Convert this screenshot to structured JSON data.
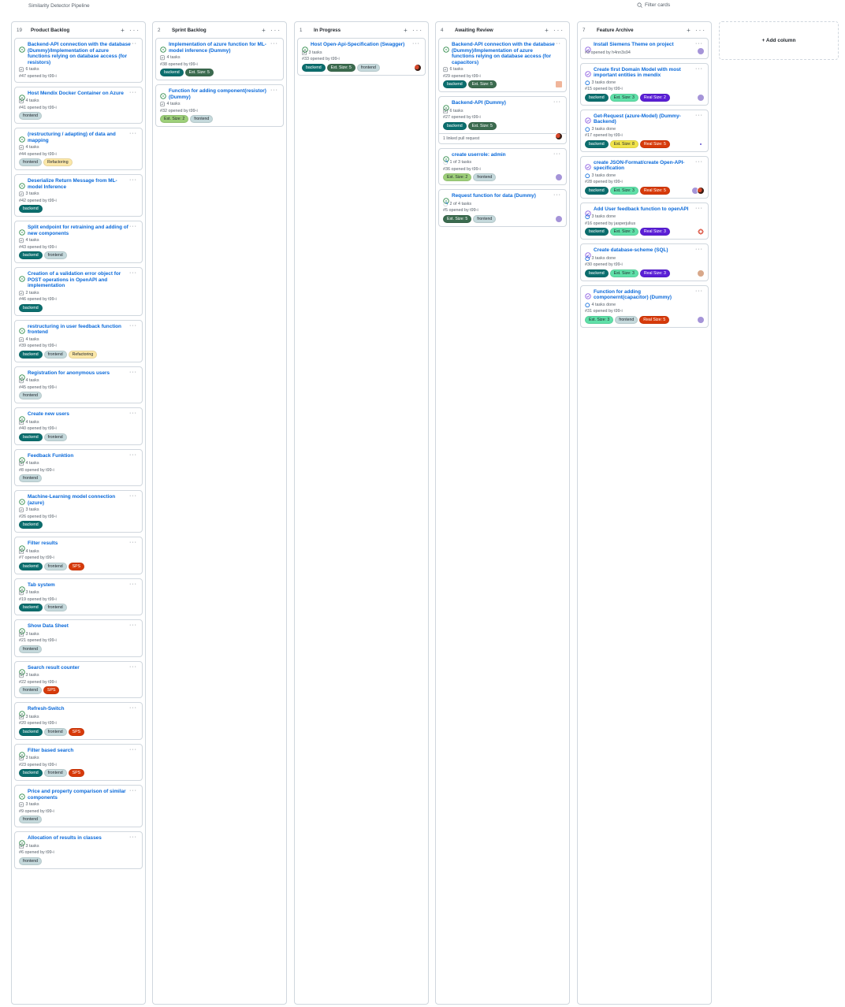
{
  "project_title": "Similarity Detector Pipeline",
  "filter": {
    "placeholder": "Filter cards"
  },
  "add_column": "+ Add column",
  "columns": [
    {
      "count": "19",
      "name": "Product Backlog",
      "cards": [
        {
          "title": "Backend-API connection with the database (Dummy)/Implementation of azure functions relying on database access (for resistors)",
          "tasks": "6 tasks",
          "opened": "#47 opened by t99-i",
          "labels": []
        },
        {
          "title": "Host Mendix Docker Container on Azure",
          "tasks": "4 tasks",
          "opened": "#41 opened by t99-i",
          "labels": [
            "frontend"
          ]
        },
        {
          "title": "(restructuring / adapting) of data and mapping",
          "tasks": "4 tasks",
          "opened": "#44 opened by t99-i",
          "labels": [
            "frontend",
            "Refactoring"
          ]
        },
        {
          "title": "Deserialize Return Message from ML-model Inference",
          "tasks": "3 tasks",
          "opened": "#42 opened by t99-i",
          "labels": [
            "backend"
          ]
        },
        {
          "title": "Split endpoint for retraining and adding of new components",
          "tasks": "4 tasks",
          "opened": "#43 opened by t99-i",
          "labels": [
            "backend",
            "frontend"
          ]
        },
        {
          "title": "Creation of a validation error object for POST operations in OpenAPI and implementation",
          "tasks": "2 tasks",
          "opened": "#46 opened by t99-i",
          "labels": [
            "backend"
          ]
        },
        {
          "title": "restructuring in user feedback function frontend",
          "tasks": "4 tasks",
          "opened": "#39 opened by t99-i",
          "labels": [
            "backend",
            "frontend",
            "Refactoring"
          ]
        },
        {
          "title": "Registration for anonymous users",
          "tasks": "4 tasks",
          "opened": "#45 opened by t99-i",
          "labels": [
            "frontend"
          ]
        },
        {
          "title": "Create new users",
          "tasks": "4 tasks",
          "opened": "#40 opened by t99-i",
          "labels": [
            "backend",
            "frontend"
          ]
        },
        {
          "title": "Feedback Funktion",
          "tasks": "4 tasks",
          "opened": "#8 opened by t99-i",
          "labels": [
            "frontend"
          ]
        },
        {
          "title": "Machine-Learning model connection (azure)",
          "tasks": "3 tasks",
          "opened": "#26 opened by t99-i",
          "labels": [
            "backend"
          ]
        },
        {
          "title": "Filter results",
          "tasks": "4 tasks",
          "opened": "#7 opened by t99-i",
          "labels": [
            "backend",
            "frontend",
            "SPS"
          ]
        },
        {
          "title": "Tab system",
          "tasks": "3 tasks",
          "opened": "#19 opened by t99-i",
          "labels": [
            "backend",
            "frontend"
          ]
        },
        {
          "title": "Show Data Sheet",
          "tasks": "3 tasks",
          "opened": "#21 opened by t99-i",
          "labels": [
            "frontend"
          ]
        },
        {
          "title": "Search result counter",
          "tasks": "3 tasks",
          "opened": "#22 opened by t99-i",
          "labels": [
            "frontend",
            "SPS"
          ]
        },
        {
          "title": "Refresh-Switch",
          "tasks": "3 tasks",
          "opened": "#20 opened by t99-i",
          "labels": [
            "backend",
            "frontend",
            "SPS"
          ]
        },
        {
          "title": "Filter based search",
          "tasks": "3 tasks",
          "opened": "#23 opened by t99-i",
          "labels": [
            "backend",
            "frontend",
            "SPS"
          ]
        },
        {
          "title": "Price and property comparison of similar components",
          "tasks": "3 tasks",
          "opened": "#9 opened by t99-i",
          "labels": [
            "frontend"
          ]
        },
        {
          "title": "Allocation of results in classes",
          "tasks": "3 tasks",
          "opened": "#6 opened by t99-i",
          "labels": [
            "frontend"
          ]
        }
      ]
    },
    {
      "count": "2",
      "name": "Sprint Backlog",
      "cards": [
        {
          "title": "Implementation of azure function for ML-model inference (Dummy)",
          "tasks": "4 tasks",
          "opened": "#38 opened by t99-i",
          "labels": [
            "backend",
            "Est. Size: 5"
          ]
        },
        {
          "title": "Function for adding component(resistor) (Dummy)",
          "tasks": "4 tasks",
          "opened": "#32 opened by t99-i",
          "labels": [
            "Est. Size: 2",
            "frontend"
          ]
        }
      ]
    },
    {
      "count": "1",
      "name": "In Progress",
      "cards": [
        {
          "title": "Host Open-Api-Specification (Swagger)",
          "tasks": "3 tasks",
          "opened": "#33 opened by t99-i",
          "labels": [
            "backend",
            "Est. Size: 5",
            "frontend"
          ],
          "avatars": [
            "red-dark"
          ]
        }
      ]
    },
    {
      "count": "4",
      "name": "Awaiting Review",
      "cards": [
        {
          "title": "Backend-API connection with the database (Dummy)/Implementation of azure functions relying on database access (for capacitors)",
          "tasks": "6 tasks",
          "opened": "#29 opened by t99-i",
          "labels": [
            "backend",
            "Est. Size: 5"
          ],
          "avatars": [
            "peach"
          ]
        },
        {
          "title": "Backend-API (Dummy)",
          "tasks": "6 tasks",
          "opened": "#27 opened by t99-i",
          "labels": [
            "backend",
            "Est. Size: 5"
          ],
          "avatars": [
            "red-dark"
          ],
          "linked": "1 linked pull request"
        },
        {
          "title": "create userrole: admin",
          "tasks": "1 of 3 tasks",
          "progress": true,
          "opened": "#36 opened by t99-i",
          "labels": [
            "Est. Size: 2",
            "frontend"
          ],
          "avatars": [
            "purple"
          ]
        },
        {
          "title": "Request function for data (Dummy)",
          "tasks": "2 of 4 tasks",
          "progress": true,
          "opened": "#5 opened by t99-i",
          "labels": [
            "Est. Size: 5",
            "frontend"
          ],
          "avatars": [
            "purple"
          ]
        }
      ]
    },
    {
      "count": "7",
      "name": "Feature Archive",
      "cards": [
        {
          "title": "Install Siemens Theme on project",
          "opened": "#3 opened by h4nn3s94",
          "labels": [],
          "done": true,
          "avatars": [
            "purple"
          ]
        },
        {
          "title": "Create first Domain Model with most important entities in mendix",
          "tasks": "3 tasks done",
          "taskdone": true,
          "opened": "#15 opened by t99-i",
          "labels": [
            "backend",
            "Est. Size: 3",
            "Real Size: 2"
          ],
          "done": true,
          "avatars": [
            "purple"
          ]
        },
        {
          "title": "Get-Request (azure-Model) (Dummy-Backend)",
          "tasks": "3 tasks done",
          "taskdone": true,
          "opened": "#17 opened by t99-i",
          "labels": [
            "backend",
            "Est. Size: 8",
            "Real Size: 5"
          ],
          "done": true,
          "avatars": [
            "dots"
          ]
        },
        {
          "title": "create JSON-Format/create Open-API-specification",
          "tasks": "3 tasks done",
          "taskdone": true,
          "opened": "#28 opened by t99-i",
          "labels": [
            "backend",
            "Est. Size: 3",
            "Real Size: 5"
          ],
          "done": true,
          "avatars": [
            "purple",
            "red-dark"
          ]
        },
        {
          "title": "Add User feedback function to openAPI",
          "tasks": "3 tasks done",
          "taskdone": true,
          "opened": "#16 opened by jasperjulius",
          "labels": [
            "backend",
            "Est. Size: 3",
            "Real Size: 3"
          ],
          "done": true,
          "avatars": [
            "ring"
          ]
        },
        {
          "title": "Create database-scheme (SQL)",
          "tasks": "3 tasks done",
          "taskdone": true,
          "opened": "#30 opened by t99-i",
          "labels": [
            "backend",
            "Est. Size: 3",
            "Real Size: 3"
          ],
          "done": true,
          "avatars": [
            "tan"
          ]
        },
        {
          "title": "Function for adding componernt(capacitor) (Dummy)",
          "tasks": "4 tasks done",
          "taskdone": true,
          "opened": "#31 opened by t99-i",
          "labels": [
            "Est. Size: 3",
            "frontend",
            "Real Size: 5"
          ],
          "done": true,
          "avatars": [
            "purple"
          ]
        }
      ]
    }
  ],
  "label_colors": {
    "backend": "#0b6e6e",
    "frontend": "#c5d9dc",
    "Refactoring": "#fbe7a8",
    "SPS": "#d73a0a",
    "Est. Size: 5": "#3b6b4f",
    "Est. Size: 2": "#9ed07a",
    "Est. Size: 3": "#5fe0a8",
    "Est. Size: 8": "#f0e34a",
    "Real Size: 2": "#5a1fd6",
    "Real Size: 3": "#5a1fd6",
    "Real Size: 5": "#d73a0a"
  },
  "label_text_light": [
    "backend",
    "SPS",
    "Est. Size: 5",
    "Real Size: 2",
    "Real Size: 3",
    "Real Size: 5"
  ],
  "icon_names": {
    "open_issue": "issue-open-icon",
    "closed_issue": "issue-closed-icon",
    "tasks": "checklist-icon",
    "more": "kebab-icon",
    "add": "plus-icon"
  }
}
